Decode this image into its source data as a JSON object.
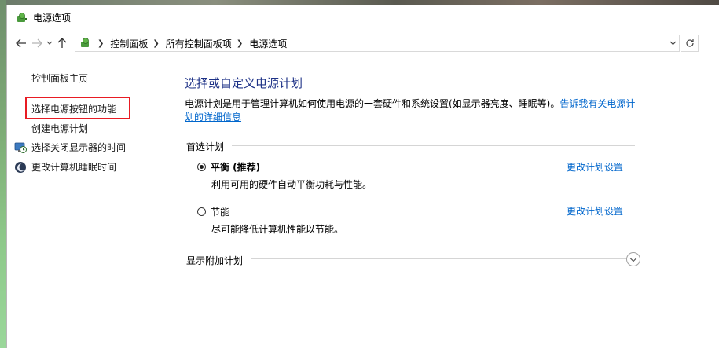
{
  "window": {
    "title": "电源选项",
    "icon": "power-options-icon"
  },
  "nav": {
    "back_icon": "back-arrow-icon",
    "forward_icon": "forward-arrow-icon",
    "recent_icon": "chevron-down-icon",
    "up_icon": "up-arrow-icon",
    "breadcrumbs": [
      "控制面板",
      "所有控制面板项",
      "电源选项"
    ],
    "address_icon": "control-panel-icon",
    "dropdown_icon": "chevron-down-icon",
    "refresh_icon": "refresh-icon"
  },
  "sidebar": {
    "home": "控制面板主页",
    "items": [
      {
        "label": "选择电源按钮的功能",
        "highlighted": true
      },
      {
        "label": "创建电源计划"
      },
      {
        "label": "选择关闭显示器的时间",
        "icon": "display-time-icon"
      },
      {
        "label": "更改计算机睡眠时间",
        "icon": "sleep-moon-icon"
      }
    ]
  },
  "main": {
    "title": "选择或自定义电源计划",
    "description": "电源计划是用于管理计算机如何使用电源的一套硬件和系统设置(如显示器亮度、睡眠等)。",
    "learn_more_link_part1": "告诉我有关电源计",
    "learn_more_link_part2": "划的详细信息",
    "preferred_section": "首选计划",
    "plans": [
      {
        "name": "平衡 (推荐)",
        "description": "利用可用的硬件自动平衡功耗与性能。",
        "selected": true,
        "link": "更改计划设置"
      },
      {
        "name": "节能",
        "description": "尽可能降低计算机性能以节能。",
        "selected": false,
        "link": "更改计划设置"
      }
    ],
    "more_section": "显示附加计划",
    "expand_icon": "chevron-down-circle-icon"
  },
  "colors": {
    "heading": "#1e3287",
    "link": "#0066cc",
    "highlight_border": "#e81b23"
  }
}
